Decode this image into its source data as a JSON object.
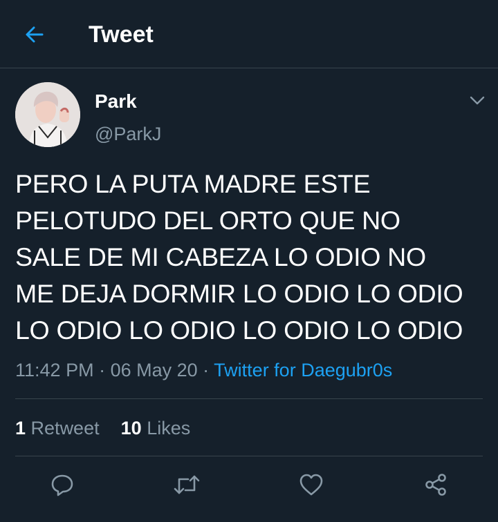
{
  "header": {
    "title": "Tweet",
    "back_icon": "arrow-left-icon"
  },
  "tweet": {
    "author": {
      "name": "Park",
      "handle": "@ParkJ"
    },
    "text": "PERO LA PUTA MADRE ESTE\nPELOTUDO DEL ORTO QUE NO\nSALE DE MI CABEZA LO ODIO NO\nME DEJA DORMIR LO ODIO LO ODIO\nLO ODIO LO ODIO LO ODIO LO ODIO",
    "time": "11:42 PM",
    "separator": " · ",
    "date": "06 May 20",
    "separator2": " · ",
    "source": "Twitter for Daegubr0s",
    "stats": {
      "retweets": "1",
      "retweets_label": "Retweet",
      "likes": "10",
      "likes_label": "Likes"
    }
  },
  "actions": [
    "reply-icon",
    "retweet-icon",
    "like-icon",
    "share-icon"
  ],
  "colors": {
    "background": "#15202b",
    "accent": "#1da1f2",
    "secondary_text": "#8899a6",
    "divider": "#38444d"
  }
}
